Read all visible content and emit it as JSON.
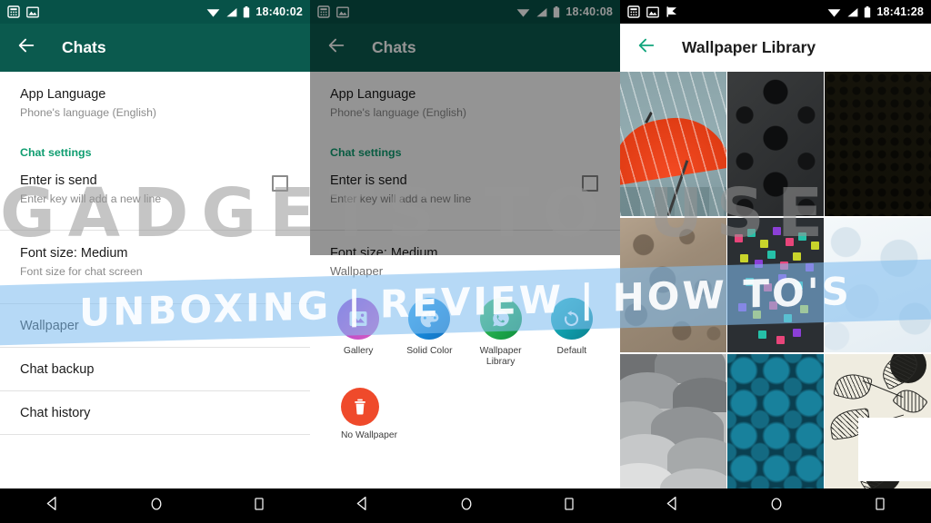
{
  "panels": [
    {
      "id": "chats-settings",
      "statusbar": {
        "time": "18:40:02",
        "left_icons": [
          "calculator-icon",
          "image-icon"
        ],
        "right_icons": [
          "wifi-icon",
          "signal-icon",
          "battery-icon"
        ],
        "background": "#075248"
      },
      "appbar": {
        "back": "back-arrow",
        "title": "Chats",
        "background": "#0b5a4e"
      },
      "rows": [
        {
          "title": "App Language",
          "sub": "Phone's language (English)"
        }
      ],
      "section_label": "Chat settings",
      "settings": [
        {
          "title": "Enter is send",
          "sub": "Enter key will add a new line",
          "checkbox": false
        },
        {
          "title": "Font size: Medium",
          "sub": "Font size for chat screen"
        }
      ],
      "simple_rows": [
        "Wallpaper",
        "Chat backup",
        "Chat history"
      ]
    },
    {
      "id": "wallpaper-chooser",
      "statusbar": {
        "time": "18:40:08",
        "left_icons": [
          "calculator-icon",
          "image-icon"
        ],
        "right_icons": [
          "wifi-icon",
          "signal-icon",
          "battery-icon"
        ],
        "background": "#075248"
      },
      "appbar": {
        "back": "back-arrow",
        "title": "Chats",
        "background": "#0b5a4e"
      },
      "dialog": {
        "title": "Wallpaper",
        "options": [
          {
            "label": "Gallery",
            "icon": "gallery-icon",
            "color": "#a13fd4"
          },
          {
            "label": "Solid Color",
            "icon": "palette-icon",
            "color": "#1a92e0"
          },
          {
            "label": "Wallpaper Library",
            "icon": "whatsapp-icon",
            "color": "#20a84a"
          },
          {
            "label": "Default",
            "icon": "restore-icon",
            "color": "#0f9fa8"
          }
        ],
        "remove": {
          "label": "No Wallpaper",
          "icon": "trash-icon",
          "color": "#ef4a2b"
        }
      }
    },
    {
      "id": "wallpaper-library",
      "statusbar": {
        "time": "18:41:28",
        "left_icons": [
          "calculator-icon",
          "image-icon",
          "flag-icon"
        ],
        "right_icons": [
          "wifi-icon",
          "signal-icon",
          "battery-icon"
        ],
        "background": "#000000"
      },
      "appbar": {
        "back": "back-arrow",
        "title": "Wallpaper Library",
        "background": "#ffffff"
      },
      "gallery": [
        {
          "name": "red-umbrella-in-rain"
        },
        {
          "name": "dark-damask-pattern"
        },
        {
          "name": "dark-dotted-pattern"
        },
        {
          "name": "lunar-surface"
        },
        {
          "name": "colored-squares-dark"
        },
        {
          "name": "light-floral-pattern"
        },
        {
          "name": "grey-cloud-scales"
        },
        {
          "name": "teal-geometric-pattern"
        },
        {
          "name": "botanical-leaf-sketch"
        }
      ]
    }
  ],
  "navbar": {
    "back": "nav-back-icon",
    "home": "nav-home-icon",
    "recents": "nav-recents-icon"
  },
  "watermark": {
    "top_text": "GADGETS TO USE",
    "band_text": "UNBOXING | REVIEW | HOW TO'S",
    "band_color": "#82bef0"
  }
}
